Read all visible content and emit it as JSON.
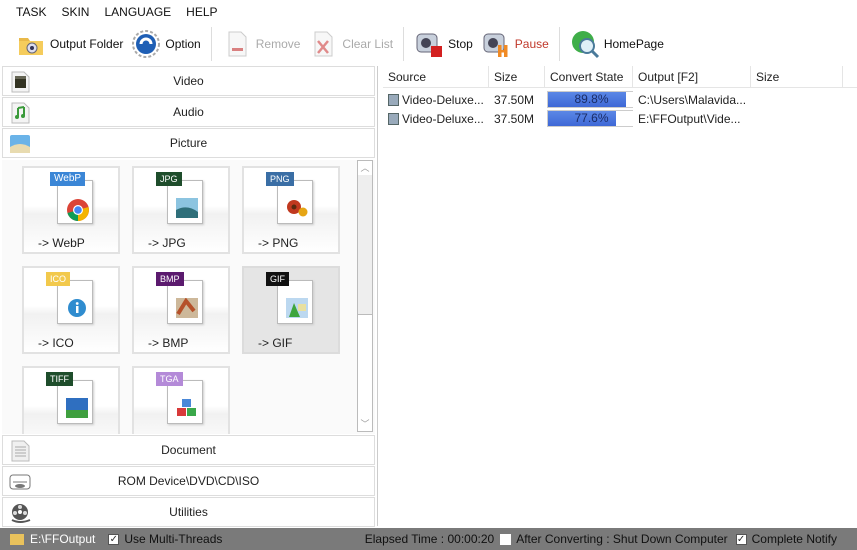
{
  "menu": [
    "TASK",
    "SKIN",
    "LANGUAGE",
    "HELP"
  ],
  "toolbar": {
    "output_folder": "Output Folder",
    "option": "Option",
    "remove": "Remove",
    "clear_list": "Clear List",
    "stop": "Stop",
    "pause": "Pause",
    "homepage": "HomePage"
  },
  "categories": {
    "video": "Video",
    "audio": "Audio",
    "picture": "Picture",
    "document": "Document",
    "rom": "ROM Device\\DVD\\CD\\ISO",
    "utilities": "Utilities"
  },
  "formats": [
    {
      "tag": "WebP",
      "label": "-> WebP",
      "color": "#3b86d6"
    },
    {
      "tag": "JPG",
      "label": "-> JPG",
      "color": "#1e4d2b"
    },
    {
      "tag": "PNG",
      "label": "-> PNG",
      "color": "#3a6ea5"
    },
    {
      "tag": "ICO",
      "label": "-> ICO",
      "color": "#f2c94c"
    },
    {
      "tag": "BMP",
      "label": "-> BMP",
      "color": "#5b1a6e"
    },
    {
      "tag": "GIF",
      "label": "-> GIF",
      "color": "#111111"
    },
    {
      "tag": "TIFF",
      "label": "",
      "color": "#1e4d2b"
    },
    {
      "tag": "TGA",
      "label": "",
      "color": "#b48ad8"
    }
  ],
  "table": {
    "headers": [
      "Source",
      "Size",
      "Convert State",
      "Output [F2]",
      "Size"
    ],
    "rows": [
      {
        "source": "Video-Deluxe...",
        "size": "37.50M",
        "progress": 89.8,
        "progress_label": "89.8%",
        "output": "C:\\Users\\Malavida...",
        "out_size": ""
      },
      {
        "source": "Video-Deluxe...",
        "size": "37.50M",
        "progress": 77.6,
        "progress_label": "77.6%",
        "output": "E:\\FFOutput\\Vide...",
        "out_size": ""
      }
    ]
  },
  "status": {
    "output_path": "E:\\FFOutput",
    "multi_threads": "Use Multi-Threads",
    "multi_threads_checked": true,
    "elapsed": "Elapsed Time : 00:00:20",
    "shutdown": "After Converting : Shut Down Computer",
    "shutdown_checked": false,
    "notify": "Complete Notify",
    "notify_checked": true
  }
}
